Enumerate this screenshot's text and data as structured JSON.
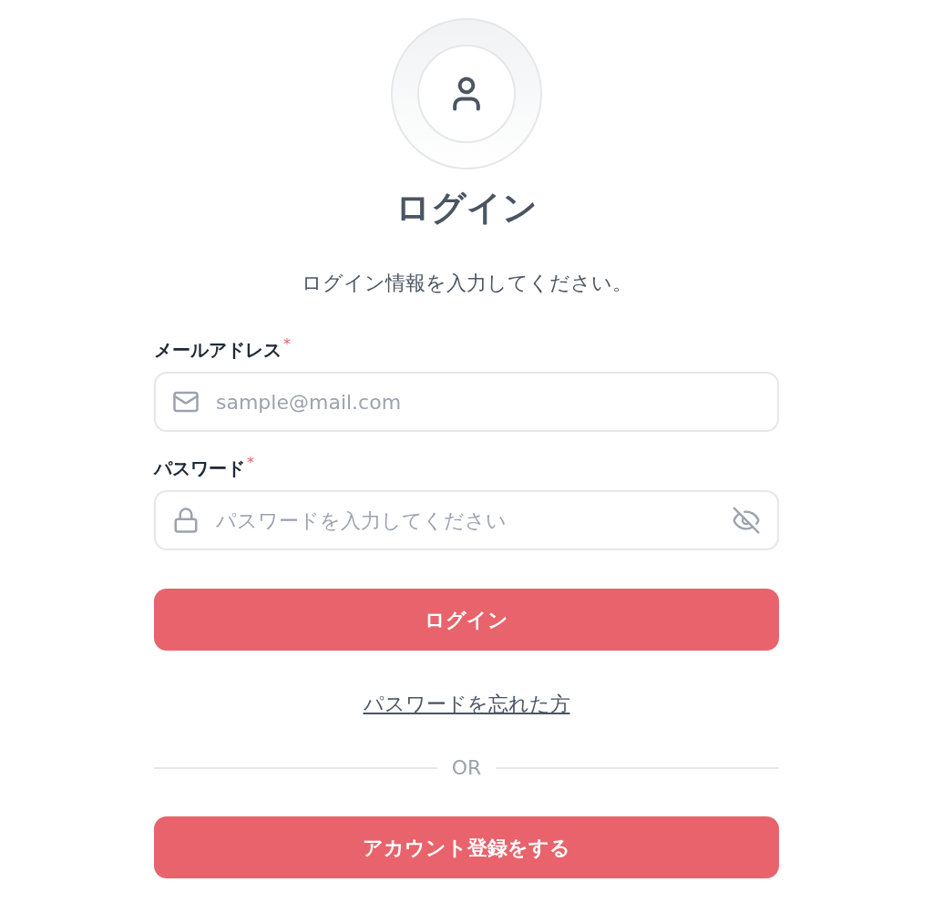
{
  "title": "ログイン",
  "subtitle": "ログイン情報を入力してください。",
  "fields": [
    {
      "kind": "email",
      "label": "メールアドレス",
      "required": true,
      "required_mark": "*",
      "placeholder": "sample@mail.com"
    },
    {
      "kind": "password",
      "label": "パスワード",
      "required": true,
      "required_mark": "*",
      "placeholder": "パスワードを入力してください"
    }
  ],
  "login_button": "ログイン",
  "forgot_link": "パスワードを忘れた方",
  "divider_text": "OR",
  "register_button": "アカウント登録をする"
}
